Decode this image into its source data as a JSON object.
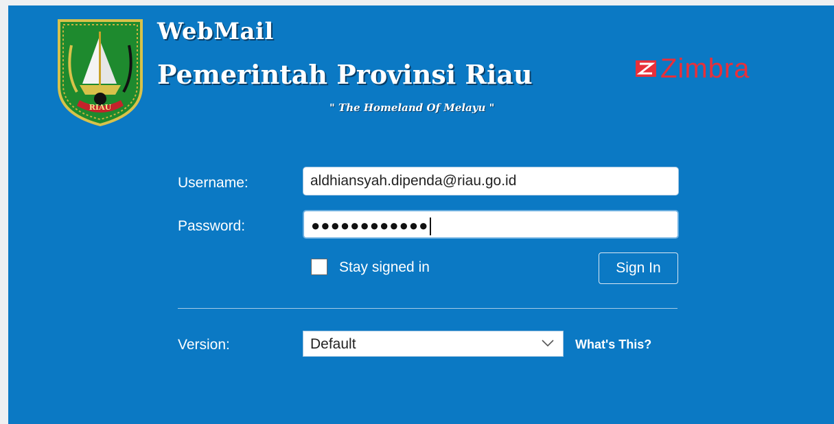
{
  "header": {
    "title_line1": "WebMail",
    "title_line2": "Pemerintah Provinsi Riau",
    "tagline": "\" The Homeland Of Melayu \"",
    "logo_text": "RIAU",
    "brand": "Zimbra"
  },
  "form": {
    "username_label": "Username:",
    "username_value": "aldhiansyah.dipenda@riau.go.id",
    "password_label": "Password:",
    "password_masked": "●●●●●●●●●●●●",
    "stay_signed_in_label": "Stay signed in",
    "stay_signed_in_checked": false,
    "sign_in_label": "Sign In",
    "version_label": "Version:",
    "version_selected": "Default",
    "whats_this_label": "What's This?"
  },
  "colors": {
    "panel": "#0b79c4",
    "zimbra_red": "#e8303a",
    "logo_green": "#1e8a2e"
  }
}
